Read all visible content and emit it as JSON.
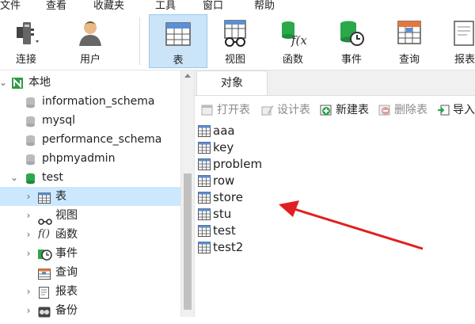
{
  "menu": [
    {
      "key": "file",
      "label": "文件"
    },
    {
      "key": "view",
      "label": "查看"
    },
    {
      "key": "favorites",
      "label": "收藏夹"
    },
    {
      "key": "tools",
      "label": "工具"
    },
    {
      "key": "window",
      "label": "窗口"
    },
    {
      "key": "help",
      "label": "帮助"
    }
  ],
  "toolbar": {
    "connect": "连接",
    "user": "用户",
    "table": "表",
    "view": "视图",
    "function": "函数",
    "event": "事件",
    "query": "查询",
    "report": "报表"
  },
  "sidebar": {
    "root": "本地",
    "databases": [
      "information_schema",
      "mysql",
      "performance_schema",
      "phpmyadmin",
      "test"
    ],
    "test_children": {
      "table": "表",
      "view": "视图",
      "function": "函数",
      "event": "事件",
      "query": "查询",
      "report": "报表",
      "backup": "备份"
    }
  },
  "content": {
    "tab": "对象",
    "actions": {
      "open": "打开表",
      "design": "设计表",
      "new": "新建表",
      "delete": "删除表",
      "import": "导入"
    },
    "tables": [
      "aaa",
      "key",
      "problem",
      "row",
      "store",
      "stu",
      "test",
      "test2"
    ]
  },
  "colors": {
    "selection": "#cce8ff",
    "active_tool": "#cce4f7",
    "annotation_arrow": "#e02020",
    "db_icon": "#2aa84a"
  }
}
